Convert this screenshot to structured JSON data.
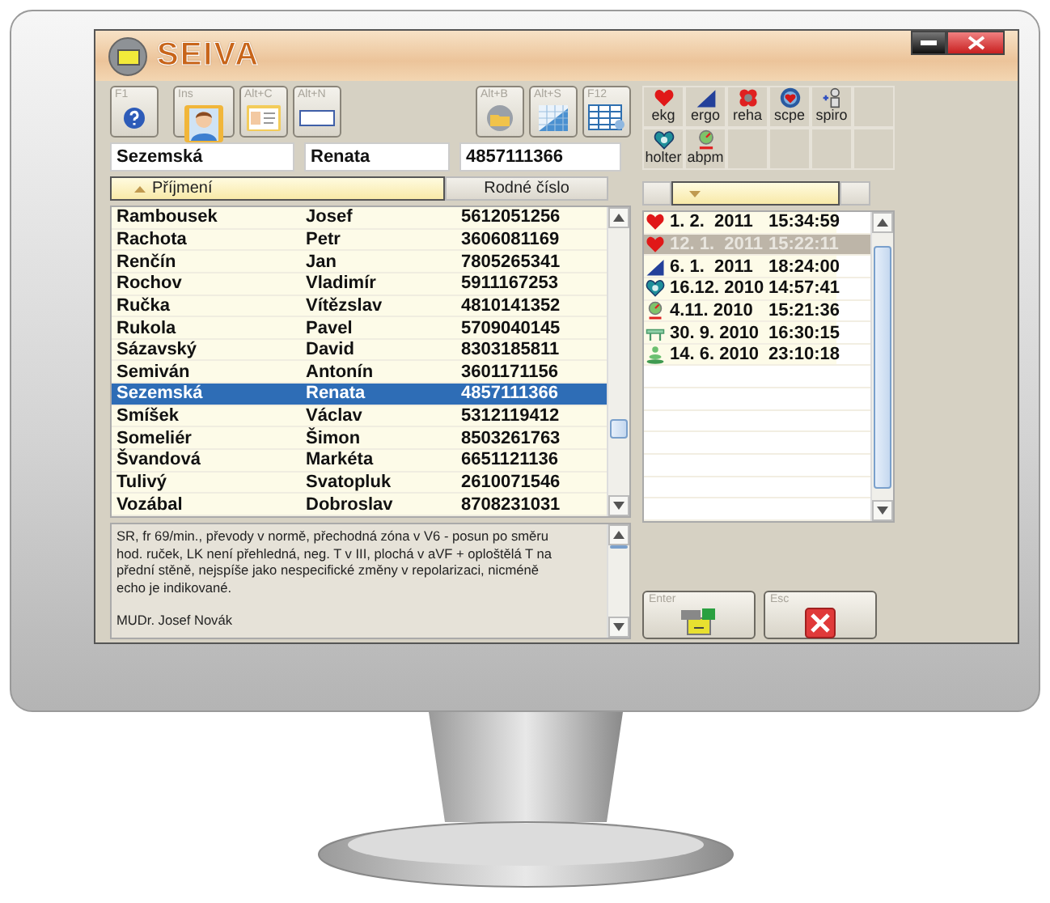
{
  "window": {
    "title": "SEIVA"
  },
  "toolbar": {
    "groups": [
      [
        {
          "hotkey": "F1",
          "kind": "help"
        }
      ],
      [
        {
          "hotkey": "Ins",
          "kind": "person"
        },
        {
          "hotkey": "Alt+C",
          "kind": "card"
        },
        {
          "hotkey": "Alt+N",
          "kind": "blank"
        }
      ],
      [
        {
          "hotkey": "Alt+B",
          "kind": "disc"
        },
        {
          "hotkey": "Alt+S",
          "kind": "chart"
        },
        {
          "hotkey": "F12",
          "kind": "table"
        }
      ]
    ]
  },
  "fields": [
    {
      "value": "Sezemská"
    },
    {
      "value": "Renata"
    },
    {
      "value": "4857111366"
    }
  ],
  "table": {
    "columns": [
      {
        "label": "Příjmení",
        "sorted": true
      },
      {
        "label": "Rodné číslo",
        "sorted": false
      }
    ],
    "rows": [
      {
        "surname": "Rambousek",
        "first_name": "Josef",
        "birth_number": "5612051256",
        "selected": false
      },
      {
        "surname": "Rachota",
        "first_name": "Petr",
        "birth_number": "3606081169",
        "selected": false
      },
      {
        "surname": "Renčín",
        "first_name": "Jan",
        "birth_number": "7805265341",
        "selected": false
      },
      {
        "surname": "Rochov",
        "first_name": "Vladimír",
        "birth_number": "5911167253",
        "selected": false
      },
      {
        "surname": "Ručka",
        "first_name": "Vítězslav",
        "birth_number": "4810141352",
        "selected": false
      },
      {
        "surname": "Rukola",
        "first_name": "Pavel",
        "birth_number": "5709040145",
        "selected": false
      },
      {
        "surname": "Sázavský",
        "first_name": "David",
        "birth_number": "8303185811",
        "selected": false
      },
      {
        "surname": "Semiván",
        "first_name": "Antonín",
        "birth_number": "3601171156",
        "selected": false
      },
      {
        "surname": "Sezemská",
        "first_name": "Renata",
        "birth_number": "4857111366",
        "selected": true
      },
      {
        "surname": "Smíšek",
        "first_name": "Václav",
        "birth_number": "5312119412",
        "selected": false
      },
      {
        "surname": "Someliér",
        "first_name": "Šimon",
        "birth_number": "8503261763",
        "selected": false
      },
      {
        "surname": "Švandová",
        "first_name": "Markéta",
        "birth_number": "6651121136",
        "selected": false
      },
      {
        "surname": "Tulivý",
        "first_name": "Svatopluk",
        "birth_number": "2610071546",
        "selected": false
      },
      {
        "surname": "Vozábal",
        "first_name": "Dobroslav",
        "birth_number": "8708231031",
        "selected": false
      }
    ]
  },
  "note": {
    "text": "SR, fr 69/min., převody v normě, přechodná zóna v V6 - posun po směru hod. ruček, LK není přehledná, neg. T v III, plochá v aVF + oploštělá T na přední stěně, nejspíše jako nespecifické změny v repolarizaci, nicméně echo je indikované.",
    "signature": "MUDr. Josef Novák"
  },
  "exams": [
    [
      {
        "label": "ekg",
        "kind": "heart"
      },
      {
        "label": "ergo",
        "kind": "ramp"
      },
      {
        "label": "reha",
        "kind": "flower"
      },
      {
        "label": "scpe",
        "kind": "ring"
      },
      {
        "label": "spiro",
        "kind": "figure"
      }
    ],
    [
      {
        "label": "holter",
        "kind": "holter"
      },
      {
        "label": "abpm",
        "kind": "gauge"
      }
    ]
  ],
  "records_header": [
    {
      "sorted": false
    },
    {
      "sorted": true
    },
    {
      "sorted": false
    }
  ],
  "records": [
    {
      "kind": "heart",
      "date": "1. 2.  2011",
      "time": "15:34:59",
      "selected": false
    },
    {
      "kind": "heart",
      "date": "12. 1.  2011",
      "time": "15:22:11",
      "selected": true
    },
    {
      "kind": "ramp",
      "date": "6. 1.  2011",
      "time": "18:24:00",
      "selected": false
    },
    {
      "kind": "holter",
      "date": "16.12. 2010",
      "time": "14:57:41",
      "selected": false
    },
    {
      "kind": "gauge",
      "date": "4.11. 2010",
      "time": "15:21:36",
      "selected": false
    },
    {
      "kind": "bench",
      "date": "30. 9. 2010",
      "time": "16:30:15",
      "selected": false
    },
    {
      "kind": "stand",
      "date": "14. 6. 2010",
      "time": "23:10:18",
      "selected": false
    }
  ],
  "buttons": [
    {
      "hotkey": "Enter",
      "kind": "confirm"
    },
    {
      "hotkey": "Esc",
      "kind": "cancel"
    }
  ]
}
